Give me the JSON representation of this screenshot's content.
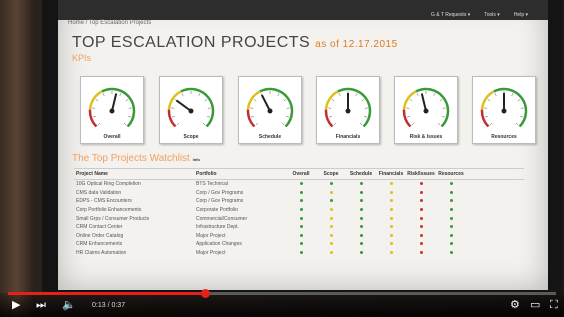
{
  "app": {
    "breadcrumb": "Home / Top Escalation Projects",
    "nav": [
      "G & T Requests ▾",
      "Tools ▾",
      "Help ▾"
    ]
  },
  "page": {
    "title": "TOP ESCALATION PROJECTS",
    "as_of": "as of 12.17.2015",
    "kpis_heading": "KPIs",
    "watchlist_heading": "The Top Projects Watchlist",
    "info_label": "info"
  },
  "gauges": [
    {
      "label": "Overall",
      "level": 0.55
    },
    {
      "label": "Scope",
      "level": 0.3
    },
    {
      "label": "Schedule",
      "level": 0.4
    },
    {
      "label": "Financials",
      "level": 0.5
    },
    {
      "label": "Risk & Issues",
      "level": 0.45
    },
    {
      "label": "Resources",
      "level": 0.5
    }
  ],
  "table": {
    "columns": [
      "Project Name",
      "Portfolio",
      "Overall",
      "Scope",
      "Schedule",
      "Financials",
      "Risk/Issues",
      "Resources"
    ],
    "rows": [
      {
        "name": "10G Optical Ring Completion",
        "portfolio": "BTS Technical",
        "status": [
          "green",
          "green",
          "green",
          "yellow",
          "red",
          "green"
        ]
      },
      {
        "name": "CMS data Validation",
        "portfolio": "Corp / Gov Programs",
        "status": [
          "green",
          "yellow",
          "green",
          "yellow",
          "red",
          "green"
        ]
      },
      {
        "name": "EDPS - CMS Encounters",
        "portfolio": "Corp / Gov Programs",
        "status": [
          "green",
          "green",
          "green",
          "yellow",
          "red",
          "green"
        ]
      },
      {
        "name": "Corp Portfolio Enhancements",
        "portfolio": "Corporate Portfolio",
        "status": [
          "green",
          "yellow",
          "green",
          "yellow",
          "red",
          "green"
        ]
      },
      {
        "name": "Small Grps / Consumer Products",
        "portfolio": "Commercial/Consumer",
        "status": [
          "green",
          "yellow",
          "green",
          "yellow",
          "red",
          "green"
        ]
      },
      {
        "name": "CRM Contact Center",
        "portfolio": "Infrastructure Dept.",
        "status": [
          "green",
          "yellow",
          "green",
          "yellow",
          "red",
          "green"
        ]
      },
      {
        "name": "Online Order Catalog",
        "portfolio": "Major Project",
        "status": [
          "green",
          "yellow",
          "green",
          "yellow",
          "red",
          "green"
        ]
      },
      {
        "name": "CRM Enhancements",
        "portfolio": "Application Changes",
        "status": [
          "green",
          "yellow",
          "green",
          "yellow",
          "red",
          "green"
        ]
      },
      {
        "name": "HR Claims Automation",
        "portfolio": "Major Project",
        "status": [
          "green",
          "yellow",
          "green",
          "yellow",
          "red",
          "green"
        ]
      }
    ]
  },
  "video": {
    "time": "0:13 / 0:37",
    "progress": 0.36,
    "icons": [
      "play-icon",
      "next-icon",
      "volume-icon",
      "settings-icon",
      "theater-icon",
      "fullscreen-icon"
    ]
  },
  "colors": {
    "accent": "#e07a22",
    "green": "#3a9a3a",
    "yellow": "#e0c020",
    "red": "#d03030",
    "progress": "#e62117"
  }
}
